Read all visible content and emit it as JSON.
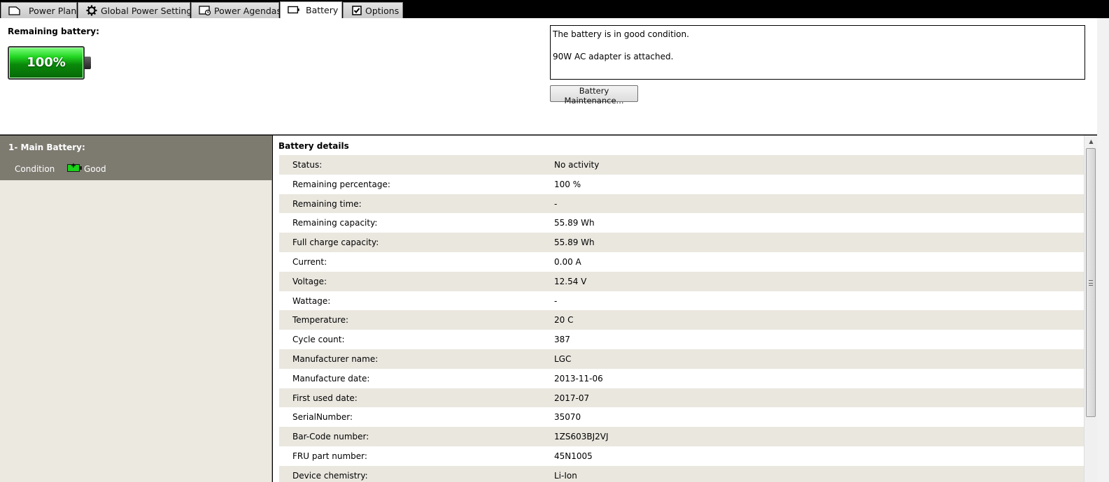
{
  "tabs": [
    {
      "label": "Power Plan",
      "icon": "power-plan-icon"
    },
    {
      "label": "Global Power Settings",
      "icon": "gear-icon"
    },
    {
      "label": "Power Agendas",
      "icon": "agenda-icon"
    },
    {
      "label": "Battery",
      "icon": "battery-icon",
      "active": true
    },
    {
      "label": "Options",
      "icon": "checkbox-icon"
    }
  ],
  "summary": {
    "remaining_label": "Remaining battery:",
    "percent_text": "100%",
    "charge_level": 100,
    "messages": [
      "The battery is in good condition.",
      "90W AC adapter is attached."
    ],
    "maintenance_button": "Battery Maintenance..."
  },
  "battery_list": {
    "title": "1- Main Battery:",
    "condition_label": "Condition",
    "condition_value": "Good"
  },
  "details": {
    "title": "Battery details",
    "rows": [
      {
        "label": "Status:",
        "value": "No activity"
      },
      {
        "label": "Remaining percentage:",
        "value": "100 %"
      },
      {
        "label": "Remaining time:",
        "value": "-"
      },
      {
        "label": "Remaining capacity:",
        "value": "55.89 Wh"
      },
      {
        "label": "Full charge capacity:",
        "value": "55.89 Wh"
      },
      {
        "label": "Current:",
        "value": "0.00 A"
      },
      {
        "label": "Voltage:",
        "value": "12.54 V"
      },
      {
        "label": "Wattage:",
        "value": "-"
      },
      {
        "label": "Temperature:",
        "value": "20 C"
      },
      {
        "label": "Cycle count:",
        "value": "387"
      },
      {
        "label": "Manufacturer name:",
        "value": "LGC"
      },
      {
        "label": "Manufacture date:",
        "value": "2013-11-06"
      },
      {
        "label": "First used date:",
        "value": "2017-07"
      },
      {
        "label": "SerialNumber:",
        "value": "35070"
      },
      {
        "label": "Bar-Code number:",
        "value": "1ZS603BJ2VJ"
      },
      {
        "label": "FRU part number:",
        "value": "45N1005"
      },
      {
        "label": "Device chemistry:",
        "value": "Li-Ion"
      }
    ]
  },
  "colors": {
    "battery_green": "#22d622",
    "panel_dark": "#7d7a70",
    "row_alt": "#eae7df"
  }
}
